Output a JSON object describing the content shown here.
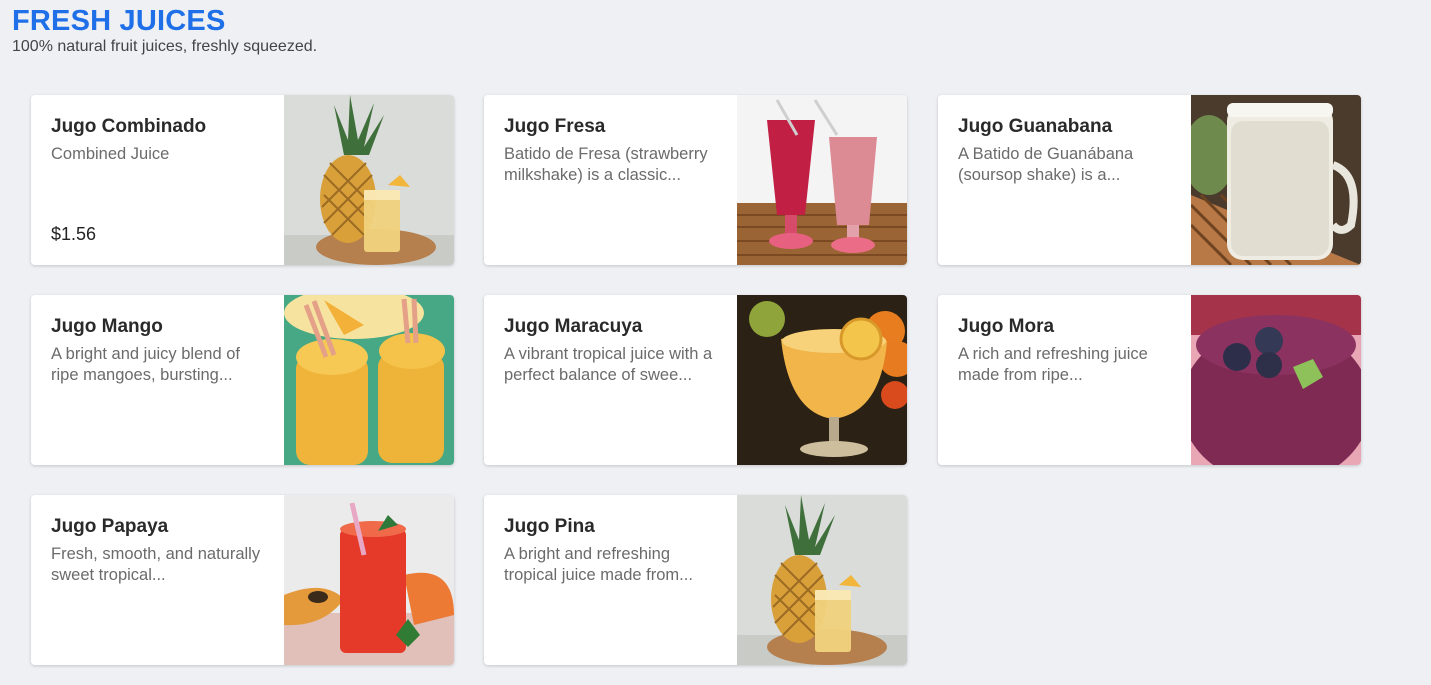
{
  "header": {
    "title": "FRESH JUICES",
    "subtitle": "100% natural fruit juices, freshly squeezed."
  },
  "colors": {
    "accent": "#1e6fe8",
    "background": "#eef0f4",
    "card": "#ffffff"
  },
  "products": [
    {
      "name": "Jugo Combinado",
      "description": "Combined Juice",
      "price": "$1.56",
      "icon": "pineapple-juice-image"
    },
    {
      "name": "Jugo Fresa",
      "description": "Batido de Fresa (strawberry milkshake) is a classic...",
      "price": "",
      "icon": "strawberry-shake-image"
    },
    {
      "name": "Jugo Guanabana",
      "description": "A Batido de Guanábana (soursop shake) is a...",
      "price": "",
      "icon": "soursop-shake-image"
    },
    {
      "name": "Jugo Mango",
      "description": "A bright and juicy blend of ripe mangoes, bursting...",
      "price": "",
      "icon": "mango-smoothie-image"
    },
    {
      "name": "Jugo Maracuya",
      "description": "A vibrant tropical juice with a perfect balance of swee...",
      "price": "",
      "icon": "passionfruit-juice-image"
    },
    {
      "name": "Jugo Mora",
      "description": "A rich and refreshing juice made from ripe...",
      "price": "",
      "icon": "blackberry-smoothie-image"
    },
    {
      "name": "Jugo Papaya",
      "description": "Fresh, smooth, and naturally sweet tropical...",
      "price": "",
      "icon": "papaya-juice-image"
    },
    {
      "name": "Jugo Pina",
      "description": "A bright and refreshing tropical juice made from...",
      "price": "",
      "icon": "pineapple-juice-image"
    }
  ]
}
